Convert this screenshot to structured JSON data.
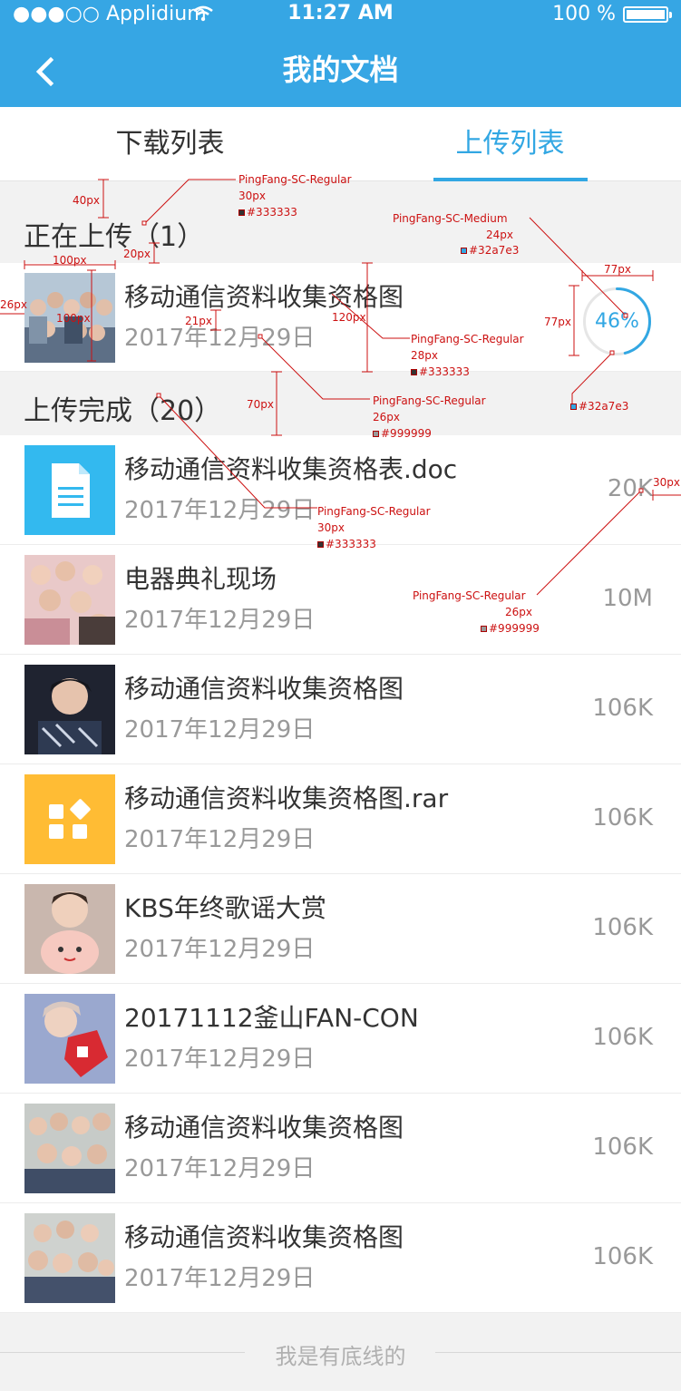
{
  "status_bar": {
    "carrier": "●●●○○ Applidium",
    "time": "11:27 AM",
    "battery": "100 %"
  },
  "nav": {
    "title": "我的文档"
  },
  "tabs": [
    {
      "label": "下载列表",
      "active": false
    },
    {
      "label": "上传列表",
      "active": true
    }
  ],
  "uploading": {
    "title": "正在上传（1）",
    "item": {
      "name": "移动通信资料收集资格图",
      "date": "2017年12月29日",
      "progress_label": "46%",
      "progress": 0.46
    }
  },
  "completed": {
    "title": "上传完成（20）",
    "items": [
      {
        "name": "移动通信资料收集资格表.doc",
        "date": "2017年12月29日",
        "size": "20K",
        "icon": "document-icon"
      },
      {
        "name": "电器典礼现场",
        "date": "2017年12月29日",
        "size": "10M",
        "icon": "photo-thumbnail"
      },
      {
        "name": "移动通信资料收集资格图",
        "date": "2017年12月29日",
        "size": "106K",
        "icon": "photo-thumbnail"
      },
      {
        "name": "移动通信资料收集资格图.rar",
        "date": "2017年12月29日",
        "size": "106K",
        "icon": "archive-icon"
      },
      {
        "name": "KBS年终歌谣大赏",
        "date": "2017年12月29日",
        "size": "106K",
        "icon": "photo-thumbnail"
      },
      {
        "name": "20171112釜山FAN-CON",
        "date": "2017年12月29日",
        "size": "106K",
        "icon": "photo-thumbnail"
      },
      {
        "name": "移动通信资料收集资格图",
        "date": "2017年12月29日",
        "size": "106K",
        "icon": "photo-thumbnail"
      },
      {
        "name": "移动通信资料收集资格图",
        "date": "2017年12月29日",
        "size": "106K",
        "icon": "photo-thumbnail"
      }
    ]
  },
  "footer": {
    "text": "我是有底线的"
  },
  "annotations": {
    "a1": "40px",
    "a2": "PingFang-SC-Regular",
    "a3": "30px",
    "a4": "#333333",
    "a5": "20px",
    "a6": "PingFang-SC-Medium",
    "a7": "24px",
    "a8": "#32a7e3",
    "a9": "100px",
    "a10": "77px",
    "a11": "26px",
    "a12": "120px",
    "a13": "100px",
    "a14": "21px",
    "a15": "PingFang-SC-Regular",
    "a16": "28px",
    "a17": "#333333",
    "a18": "77px",
    "a19": "#32a7e3",
    "a20": "70px",
    "a21": "PingFang-SC-Regular",
    "a22": "26px",
    "a23": "#999999",
    "a24": "30px",
    "a25": "PingFang-SC-Regular",
    "a26": "30px",
    "a27": "#333333",
    "a28": "PingFang-SC-Regular",
    "a29": "26px",
    "a30": "#999999"
  },
  "colors": {
    "primary": "#36a6e4",
    "accent": "#32a7e3",
    "text": "#333333",
    "subtext": "#999999",
    "annotation": "#cc1111"
  }
}
